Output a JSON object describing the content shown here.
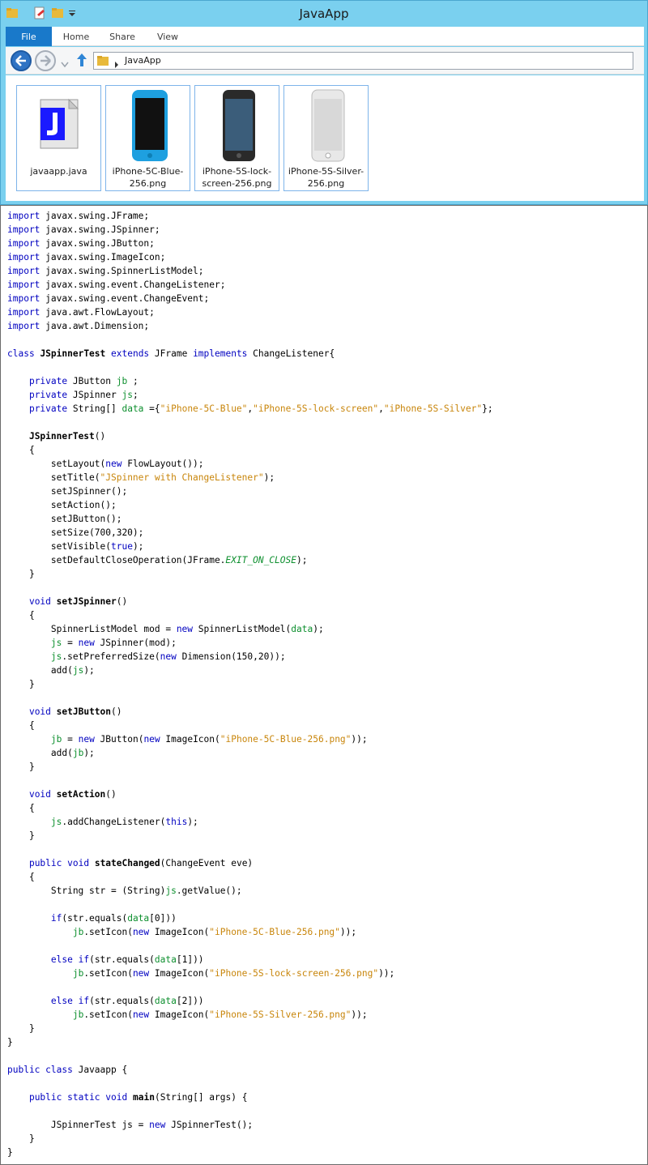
{
  "window": {
    "title": "JavaApp"
  },
  "ribbon": {
    "tabs": [
      "File",
      "Home",
      "Share",
      "View"
    ]
  },
  "address": {
    "path": "JavaApp"
  },
  "files": [
    {
      "name": "javaapp.java",
      "icon": "java-file-icon"
    },
    {
      "name": "iPhone-5C-Blue-256.png",
      "icon": "iphone-blue-thumbnail"
    },
    {
      "name": "iPhone-5S-lock-screen-256.png",
      "icon": "iphone-black-thumbnail"
    },
    {
      "name": "iPhone-5S-Silver-256.png",
      "icon": "iphone-silver-thumbnail"
    }
  ],
  "colors": {
    "keyword": "#0000c0",
    "field": "#0d8f2e",
    "string": "#c8850a",
    "accent": "#1979ca",
    "title_bar": "#7ad0ef"
  },
  "code": [
    [
      [
        "k",
        "import"
      ],
      [
        "p",
        " javax.swing.JFrame;"
      ]
    ],
    [
      [
        "k",
        "import"
      ],
      [
        "p",
        " javax.swing.JSpinner;"
      ]
    ],
    [
      [
        "k",
        "import"
      ],
      [
        "p",
        " javax.swing.JButton;"
      ]
    ],
    [
      [
        "k",
        "import"
      ],
      [
        "p",
        " javax.swing.ImageIcon;"
      ]
    ],
    [
      [
        "k",
        "import"
      ],
      [
        "p",
        " javax.swing.SpinnerListModel;"
      ]
    ],
    [
      [
        "k",
        "import"
      ],
      [
        "p",
        " javax.swing.event.ChangeListener;"
      ]
    ],
    [
      [
        "k",
        "import"
      ],
      [
        "p",
        " javax.swing.event.ChangeEvent;"
      ]
    ],
    [
      [
        "k",
        "import"
      ],
      [
        "p",
        " java.awt.FlowLayout;"
      ]
    ],
    [
      [
        "k",
        "import"
      ],
      [
        "p",
        " java.awt.Dimension;"
      ]
    ],
    [],
    [
      [
        "k",
        "class"
      ],
      [
        "p",
        " "
      ],
      [
        "b",
        "JSpinnerTest"
      ],
      [
        "p",
        " "
      ],
      [
        "k",
        "extends"
      ],
      [
        "p",
        " JFrame "
      ],
      [
        "k",
        "implements"
      ],
      [
        "p",
        " ChangeListener{"
      ]
    ],
    [],
    [
      [
        "p",
        "    "
      ],
      [
        "k",
        "private"
      ],
      [
        "p",
        " JButton "
      ],
      [
        "f",
        "jb"
      ],
      [
        "p",
        " ;"
      ]
    ],
    [
      [
        "p",
        "    "
      ],
      [
        "k",
        "private"
      ],
      [
        "p",
        " JSpinner "
      ],
      [
        "f",
        "js"
      ],
      [
        "p",
        ";"
      ]
    ],
    [
      [
        "p",
        "    "
      ],
      [
        "k",
        "private"
      ],
      [
        "p",
        " String[] "
      ],
      [
        "f",
        "data"
      ],
      [
        "p",
        " ={"
      ],
      [
        "s",
        "\"iPhone-5C-Blue\""
      ],
      [
        "p",
        ","
      ],
      [
        "s",
        "\"iPhone-5S-lock-screen\""
      ],
      [
        "p",
        ","
      ],
      [
        "s",
        "\"iPhone-5S-Silver\""
      ],
      [
        "p",
        "};"
      ]
    ],
    [],
    [
      [
        "p",
        "    "
      ],
      [
        "b",
        "JSpinnerTest"
      ],
      [
        "p",
        "()"
      ]
    ],
    [
      [
        "p",
        "    {"
      ]
    ],
    [
      [
        "p",
        "        setLayout("
      ],
      [
        "k",
        "new"
      ],
      [
        "p",
        " FlowLayout());"
      ]
    ],
    [
      [
        "p",
        "        setTitle("
      ],
      [
        "s",
        "\"JSpinner with ChangeListener\""
      ],
      [
        "p",
        ");"
      ]
    ],
    [
      [
        "p",
        "        setJSpinner();"
      ]
    ],
    [
      [
        "p",
        "        setAction();"
      ]
    ],
    [
      [
        "p",
        "        setJButton();"
      ]
    ],
    [
      [
        "p",
        "        setSize(700,320);"
      ]
    ],
    [
      [
        "p",
        "        setVisible("
      ],
      [
        "k",
        "true"
      ],
      [
        "p",
        ");"
      ]
    ],
    [
      [
        "p",
        "        setDefaultCloseOperation(JFrame."
      ],
      [
        "fi",
        "EXIT_ON_CLOSE"
      ],
      [
        "p",
        ");"
      ]
    ],
    [
      [
        "p",
        "    }"
      ]
    ],
    [],
    [
      [
        "p",
        "    "
      ],
      [
        "k",
        "void"
      ],
      [
        "p",
        " "
      ],
      [
        "b",
        "setJSpinner"
      ],
      [
        "p",
        "()"
      ]
    ],
    [
      [
        "p",
        "    {"
      ]
    ],
    [
      [
        "p",
        "        SpinnerListModel mod = "
      ],
      [
        "k",
        "new"
      ],
      [
        "p",
        " SpinnerListModel("
      ],
      [
        "f",
        "data"
      ],
      [
        "p",
        ");"
      ]
    ],
    [
      [
        "p",
        "        "
      ],
      [
        "f",
        "js"
      ],
      [
        "p",
        " = "
      ],
      [
        "k",
        "new"
      ],
      [
        "p",
        " JSpinner(mod);"
      ]
    ],
    [
      [
        "p",
        "        "
      ],
      [
        "f",
        "js"
      ],
      [
        "p",
        ".setPreferredSize("
      ],
      [
        "k",
        "new"
      ],
      [
        "p",
        " Dimension(150,20));"
      ]
    ],
    [
      [
        "p",
        "        add("
      ],
      [
        "f",
        "js"
      ],
      [
        "p",
        ");"
      ]
    ],
    [
      [
        "p",
        "    }"
      ]
    ],
    [],
    [
      [
        "p",
        "    "
      ],
      [
        "k",
        "void"
      ],
      [
        "p",
        " "
      ],
      [
        "b",
        "setJButton"
      ],
      [
        "p",
        "()"
      ]
    ],
    [
      [
        "p",
        "    {"
      ]
    ],
    [
      [
        "p",
        "        "
      ],
      [
        "f",
        "jb"
      ],
      [
        "p",
        " = "
      ],
      [
        "k",
        "new"
      ],
      [
        "p",
        " JButton("
      ],
      [
        "k",
        "new"
      ],
      [
        "p",
        " ImageIcon("
      ],
      [
        "s",
        "\"iPhone-5C-Blue-256.png\""
      ],
      [
        "p",
        "));"
      ]
    ],
    [
      [
        "p",
        "        add("
      ],
      [
        "f",
        "jb"
      ],
      [
        "p",
        ");"
      ]
    ],
    [
      [
        "p",
        "    }"
      ]
    ],
    [],
    [
      [
        "p",
        "    "
      ],
      [
        "k",
        "void"
      ],
      [
        "p",
        " "
      ],
      [
        "b",
        "setAction"
      ],
      [
        "p",
        "()"
      ]
    ],
    [
      [
        "p",
        "    {"
      ]
    ],
    [
      [
        "p",
        "        "
      ],
      [
        "f",
        "js"
      ],
      [
        "p",
        ".addChangeListener("
      ],
      [
        "k",
        "this"
      ],
      [
        "p",
        ");"
      ]
    ],
    [
      [
        "p",
        "    }"
      ]
    ],
    [],
    [
      [
        "p",
        "    "
      ],
      [
        "k",
        "public"
      ],
      [
        "p",
        " "
      ],
      [
        "k",
        "void"
      ],
      [
        "p",
        " "
      ],
      [
        "b",
        "stateChanged"
      ],
      [
        "p",
        "(ChangeEvent eve)"
      ]
    ],
    [
      [
        "p",
        "    {"
      ]
    ],
    [
      [
        "p",
        "        String str = (String)"
      ],
      [
        "f",
        "js"
      ],
      [
        "p",
        ".getValue();"
      ]
    ],
    [],
    [
      [
        "p",
        "        "
      ],
      [
        "k",
        "if"
      ],
      [
        "p",
        "(str.equals("
      ],
      [
        "f",
        "data"
      ],
      [
        "p",
        "[0]))"
      ]
    ],
    [
      [
        "p",
        "            "
      ],
      [
        "f",
        "jb"
      ],
      [
        "p",
        ".setIcon("
      ],
      [
        "k",
        "new"
      ],
      [
        "p",
        " ImageIcon("
      ],
      [
        "s",
        "\"iPhone-5C-Blue-256.png\""
      ],
      [
        "p",
        "));"
      ]
    ],
    [],
    [
      [
        "p",
        "        "
      ],
      [
        "k",
        "else"
      ],
      [
        "p",
        " "
      ],
      [
        "k",
        "if"
      ],
      [
        "p",
        "(str.equals("
      ],
      [
        "f",
        "data"
      ],
      [
        "p",
        "[1]))"
      ]
    ],
    [
      [
        "p",
        "            "
      ],
      [
        "f",
        "jb"
      ],
      [
        "p",
        ".setIcon("
      ],
      [
        "k",
        "new"
      ],
      [
        "p",
        " ImageIcon("
      ],
      [
        "s",
        "\"iPhone-5S-lock-screen-256.png\""
      ],
      [
        "p",
        "));"
      ]
    ],
    [],
    [
      [
        "p",
        "        "
      ],
      [
        "k",
        "else"
      ],
      [
        "p",
        " "
      ],
      [
        "k",
        "if"
      ],
      [
        "p",
        "(str.equals("
      ],
      [
        "f",
        "data"
      ],
      [
        "p",
        "[2]))"
      ]
    ],
    [
      [
        "p",
        "            "
      ],
      [
        "f",
        "jb"
      ],
      [
        "p",
        ".setIcon("
      ],
      [
        "k",
        "new"
      ],
      [
        "p",
        " ImageIcon("
      ],
      [
        "s",
        "\"iPhone-5S-Silver-256.png\""
      ],
      [
        "p",
        "));"
      ]
    ],
    [
      [
        "p",
        "    }"
      ]
    ],
    [
      [
        "p",
        "}"
      ]
    ],
    [],
    [
      [
        "k",
        "public"
      ],
      [
        "p",
        " "
      ],
      [
        "k",
        "class"
      ],
      [
        "p",
        " Javaapp {"
      ]
    ],
    [],
    [
      [
        "p",
        "    "
      ],
      [
        "k",
        "public"
      ],
      [
        "p",
        " "
      ],
      [
        "k",
        "static"
      ],
      [
        "p",
        " "
      ],
      [
        "k",
        "void"
      ],
      [
        "p",
        " "
      ],
      [
        "b",
        "main"
      ],
      [
        "p",
        "(String[] args) {"
      ]
    ],
    [],
    [
      [
        "p",
        "        JSpinnerTest js = "
      ],
      [
        "k",
        "new"
      ],
      [
        "p",
        " JSpinnerTest();"
      ]
    ],
    [
      [
        "p",
        "    }"
      ]
    ],
    [
      [
        "p",
        "}"
      ]
    ]
  ]
}
